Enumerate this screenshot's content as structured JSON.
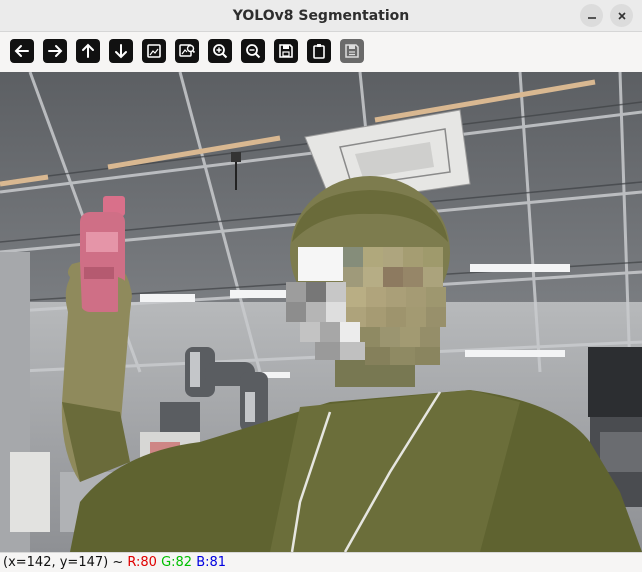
{
  "window": {
    "title": "YOLOv8 Segmentation",
    "minimize_icon": "minimize-icon",
    "close_icon": "close-icon"
  },
  "toolbar": {
    "buttons": [
      {
        "name": "pan-left",
        "icon": "arrow-left-icon"
      },
      {
        "name": "pan-right",
        "icon": "arrow-right-icon"
      },
      {
        "name": "pan-up",
        "icon": "arrow-up-icon"
      },
      {
        "name": "pan-down",
        "icon": "arrow-down-icon"
      },
      {
        "name": "zoom-reset",
        "icon": "image-icon"
      },
      {
        "name": "zoom-fit",
        "icon": "image-zoom-icon"
      },
      {
        "name": "zoom-in",
        "icon": "zoom-in-icon"
      },
      {
        "name": "zoom-out",
        "icon": "zoom-out-icon"
      },
      {
        "name": "save-image",
        "icon": "save-icon"
      },
      {
        "name": "copy-clipboard",
        "icon": "clipboard-icon"
      },
      {
        "name": "properties",
        "icon": "properties-icon",
        "disabled": true
      }
    ]
  },
  "status": {
    "coords": "(x=142, y=147) ~ ",
    "r": "R:80",
    "g": "G:82",
    "b": "B:81"
  },
  "colors": {
    "segmentation_overlay": "#6b6a3c",
    "title_bg": "#ebebeb",
    "toolbar_button": "#111111"
  }
}
